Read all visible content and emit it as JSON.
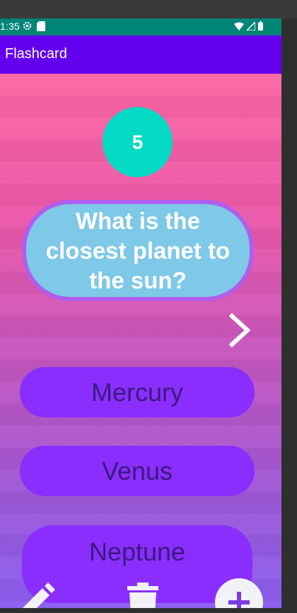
{
  "status_bar": {
    "time": "1:35",
    "icons": [
      "settings-icon",
      "sim-card-icon",
      "wifi-icon",
      "cell-signal-icon",
      "battery-icon"
    ]
  },
  "app_bar": {
    "title": "Flashcard"
  },
  "score": {
    "value": "5"
  },
  "question": {
    "text": "What is the closest planet to the sun?"
  },
  "answers": [
    {
      "label": "Mercury"
    },
    {
      "label": "Venus"
    },
    {
      "label": "Neptune"
    }
  ],
  "actions": {
    "next_icon": "chevron-right-icon",
    "edit_icon": "pencil-icon",
    "delete_icon": "trash-icon",
    "add_icon": "plus-icon"
  },
  "colors": {
    "status_bar": "#008577",
    "app_bar": "#6200ee",
    "score_circle": "#03dac5",
    "question_card": "#7ec8e8",
    "question_border": "#b15ded",
    "answer_button": "#8a2eff",
    "answer_text": "#3b1a80",
    "gradient_top": "#fe66a3",
    "gradient_bottom": "#8a5ef0"
  }
}
